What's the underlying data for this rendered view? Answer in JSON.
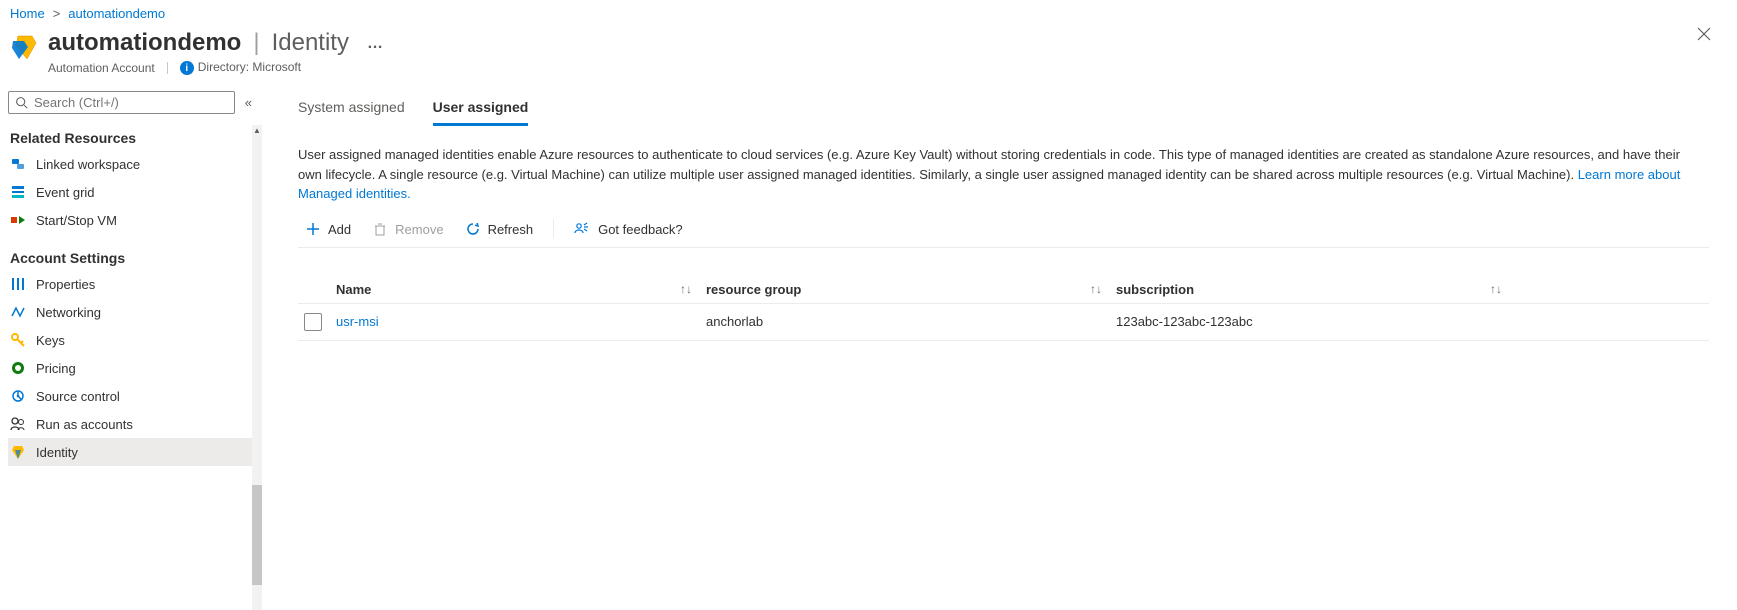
{
  "breadcrumb": {
    "home": "Home",
    "current": "automationdemo"
  },
  "header": {
    "resource_name": "automationdemo",
    "section_name": "Identity",
    "subtitle_type": "Automation Account",
    "directory_label": "Directory: Microsoft"
  },
  "search": {
    "placeholder": "Search (Ctrl+/)"
  },
  "sidebar": {
    "section_related": "Related Resources",
    "section_account": "Account Settings",
    "items_related": [
      {
        "label": "Linked workspace",
        "icon": "workspace-icon"
      },
      {
        "label": "Event grid",
        "icon": "eventgrid-icon"
      },
      {
        "label": "Start/Stop VM",
        "icon": "startstop-icon"
      }
    ],
    "items_account": [
      {
        "label": "Properties",
        "icon": "properties-icon"
      },
      {
        "label": "Networking",
        "icon": "networking-icon"
      },
      {
        "label": "Keys",
        "icon": "keys-icon"
      },
      {
        "label": "Pricing",
        "icon": "pricing-icon"
      },
      {
        "label": "Source control",
        "icon": "sourcecontrol-icon"
      },
      {
        "label": "Run as accounts",
        "icon": "runas-icon"
      },
      {
        "label": "Identity",
        "icon": "identity-icon",
        "selected": true
      }
    ]
  },
  "tabs": {
    "system": "System assigned",
    "user": "User assigned"
  },
  "description": {
    "text": "User assigned managed identities enable Azure resources to authenticate to cloud services (e.g. Azure Key Vault) without storing credentials in code. This type of managed identities are created as standalone Azure resources, and have their own lifecycle. A single resource (e.g. Virtual Machine) can utilize multiple user assigned managed identities. Similarly, a single user assigned managed identity can be shared across multiple resources (e.g. Virtual Machine). ",
    "link": "Learn more about Managed identities."
  },
  "toolbar": {
    "add": "Add",
    "remove": "Remove",
    "refresh": "Refresh",
    "feedback": "Got feedback?"
  },
  "table": {
    "columns": {
      "name": "Name",
      "rg": "resource group",
      "sub": "subscription"
    },
    "rows": [
      {
        "name": "usr-msi",
        "rg": "anchorlab",
        "sub": "123abc-123abc-123abc"
      }
    ]
  }
}
